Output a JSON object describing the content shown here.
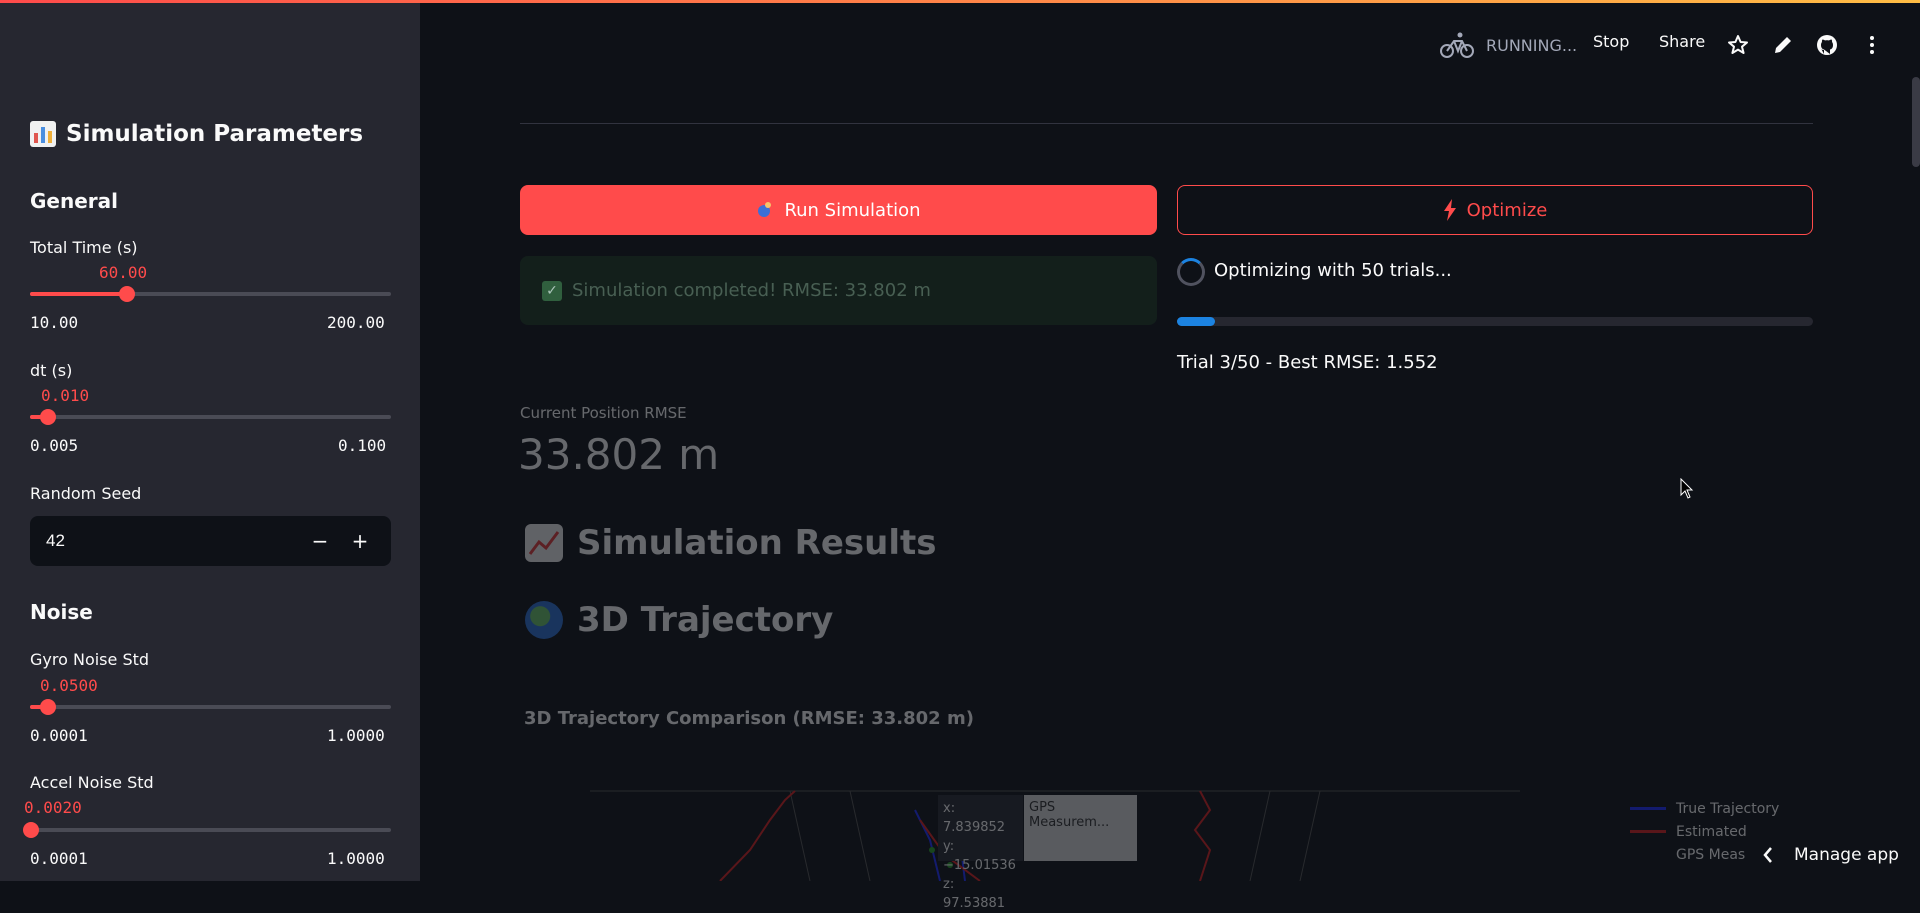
{
  "header": {
    "status": "RUNNING...",
    "stop_label": "Stop",
    "share_label": "Share"
  },
  "sidebar": {
    "title": "Simulation Parameters",
    "general_heading": "General",
    "total_time": {
      "label": "Total Time (s)",
      "value": "60.00",
      "min": "10.00",
      "max": "200.00",
      "fraction": 0.27
    },
    "dt": {
      "label": "dt (s)",
      "value": "0.010",
      "min": "0.005",
      "max": "0.100",
      "fraction": 0.05
    },
    "seed": {
      "label": "Random Seed",
      "value": "42",
      "minus": "−",
      "plus": "+"
    },
    "noise_heading": "Noise",
    "gyro": {
      "label": "Gyro Noise Std",
      "value": "0.0500",
      "min": "0.0001",
      "max": "1.0000",
      "fraction": 0.05
    },
    "accel": {
      "label": "Accel Noise Std",
      "value": "0.0020",
      "min": "0.0001",
      "max": "1.0000",
      "fraction": 0.002
    }
  },
  "main": {
    "run_button": "Run Simulation",
    "optimize_button": "Optimize",
    "success_message": "Simulation completed! RMSE: 33.802 m",
    "optimizing_text": "Optimizing with 50 trials...",
    "progress": 0.06,
    "trial_text": "Trial 3/50 - Best RMSE: 1.552",
    "metric_label": "Current Position RMSE",
    "metric_value": "33.802 m",
    "results_heading": "Simulation Results",
    "trajectory_heading": "3D Trajectory",
    "plot_title": "3D Trajectory Comparison (RMSE: 33.802 m)",
    "legend": [
      "True Trajectory",
      "Estimated",
      "GPS Meas"
    ],
    "tooltip": {
      "x": "x: 7.839852",
      "y": "y: −15.01536",
      "z": "z: 97.53881",
      "name": "GPS Measurem..."
    },
    "manage_app": "Manage app"
  },
  "colors": {
    "accent": "#ff4b4b",
    "progress": "#1c83e1",
    "true": "#1f2fff",
    "estimated": "#d62020"
  }
}
